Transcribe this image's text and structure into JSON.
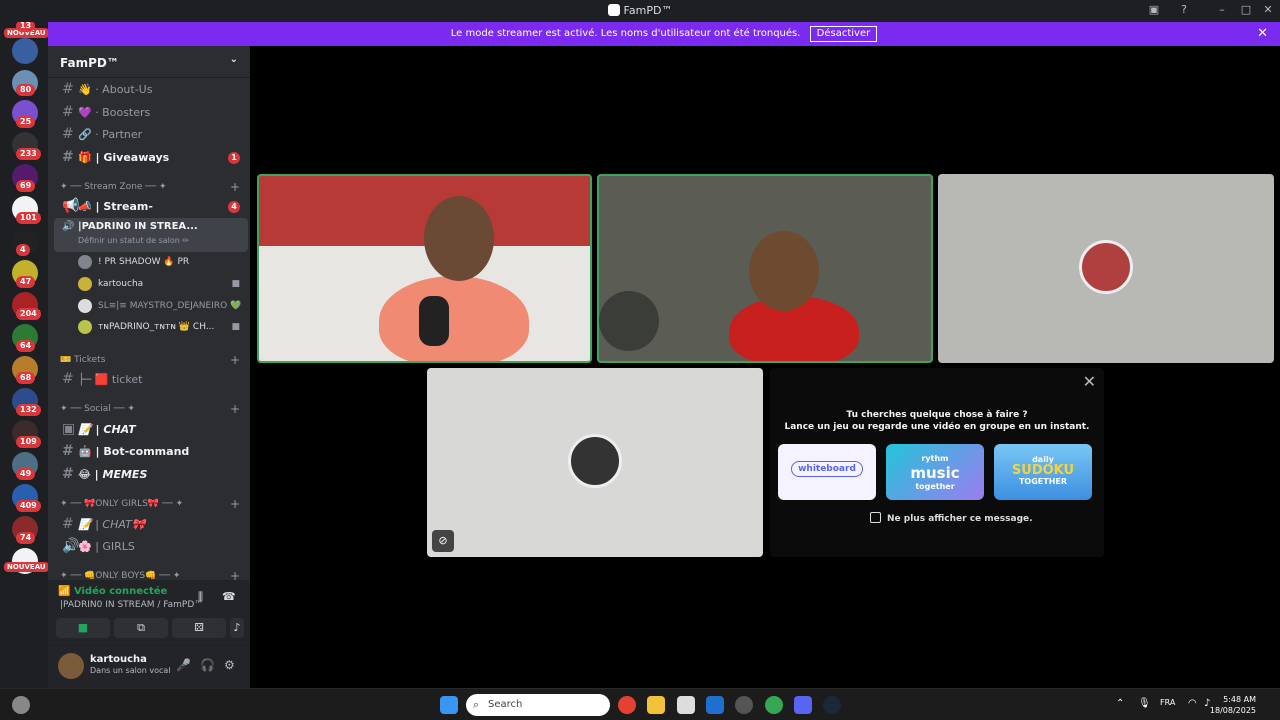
{
  "window": {
    "title": "FamPD™"
  },
  "banner": {
    "text": "Le mode streamer est activé. Les noms d'utilisateur ont été tronqués.",
    "button": "Désactiver"
  },
  "guild_bar": {
    "badges": [
      "13",
      "80",
      "25",
      "233",
      "69",
      "101",
      "4",
      "47",
      "204",
      "64",
      "68",
      "132",
      "109",
      "49",
      "409",
      "74"
    ],
    "new_label": "NOUVEAU"
  },
  "server": {
    "name": "FamPD™"
  },
  "channels": [
    {
      "label": "👋 · About-Us"
    },
    {
      "label": "💜 · Boosters"
    },
    {
      "label": "🔗 · Partner"
    },
    {
      "label": "🎁 | Giveaways",
      "unread": "1"
    },
    {
      "label": "📣 | Stream-Announcement",
      "unread": "4"
    }
  ],
  "categories": {
    "stream_zone": "✦ ── Stream Zone ── ✦",
    "tickets": "🎫 Tickets",
    "social": "✦ ── Social ── ✦",
    "only_girls": "✦ ── 🎀ONLY GIRLS🎀 ── ✦",
    "only_boys": "✦ ── 👊ONLY BOYS👊 ── ✦"
  },
  "voice_channel": {
    "name": "|PADRIN0 IN STREA...",
    "status_hint": "Définir un statut de salon ✏"
  },
  "voice_members": [
    {
      "name": "! PR SHADOW 🔥 PR"
    },
    {
      "name": "kartoucha"
    },
    {
      "name": "SL≡|≡ MAYSTRO_DEJANEIRO 💚"
    },
    {
      "name": "ᴛɴPADRINO_ᴛɴᴛɴ 👑 CH..."
    }
  ],
  "more_channels": [
    {
      "label": "├─ 🟥 ticket"
    },
    {
      "label": "📝 | CHAT"
    },
    {
      "label": "🤖 | Bot-command"
    },
    {
      "label": "😂 | MEMES"
    },
    {
      "label": "📝 | CHAT🎀"
    },
    {
      "label": "🌸 | GIRLS"
    }
  ],
  "voice_panel": {
    "status": "Vidéo connectée",
    "location": "|PADRIN0 IN STREAM / FamPD™"
  },
  "user": {
    "name": "kartoucha",
    "status": "Dans un salon vocal"
  },
  "activity": {
    "line1": "Tu cherches quelque chose à faire ?",
    "line2": "Lance un jeu ou regarde une vidéo en groupe en un instant.",
    "cards": {
      "whiteboard": "whiteboard",
      "music_top": "rythm",
      "music_main": "music",
      "music_sub": "together",
      "sudoku_top": "daily",
      "sudoku_main": "SUDOKU",
      "sudoku_sub": "TOGETHER"
    },
    "checkbox": "Ne plus afficher ce message."
  },
  "taskbar": {
    "search": "Search",
    "lang": "FRA",
    "time": "5:48 AM",
    "date": "18/08/2025"
  },
  "colors": {
    "banner": "#7b2bf0",
    "speaking": "#3ba55d",
    "unread": "#da373c",
    "connected": "#23a55a"
  }
}
